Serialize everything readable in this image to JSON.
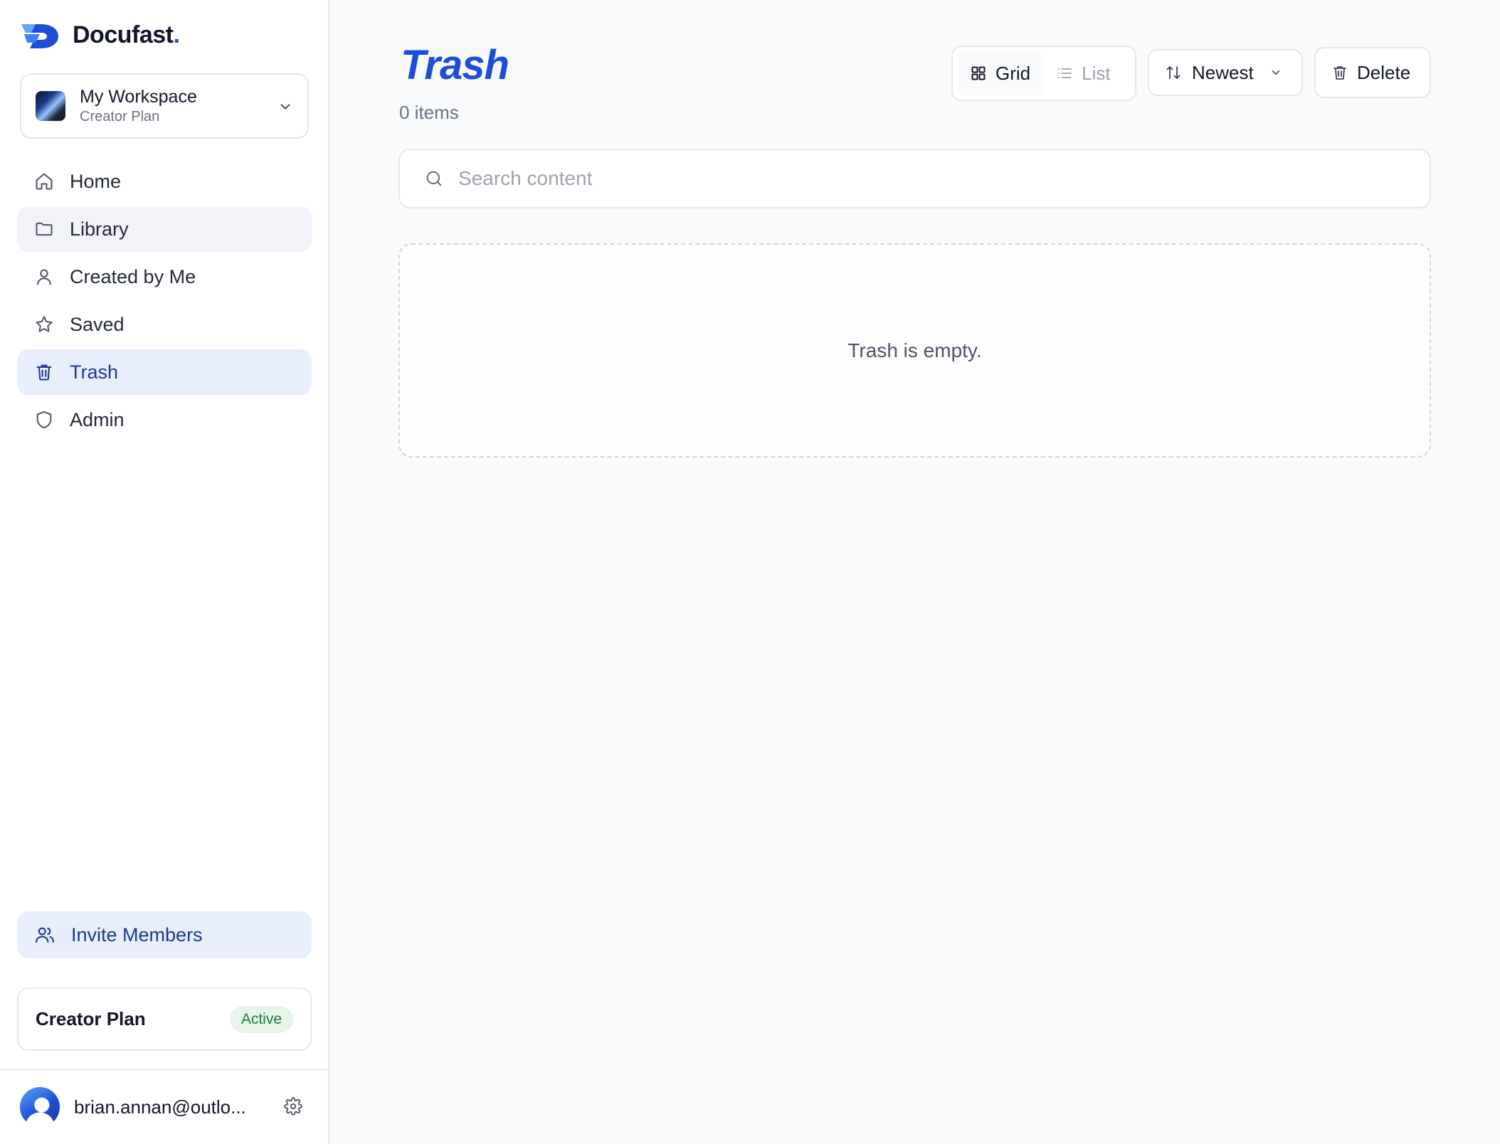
{
  "brand": {
    "name": "Docufast",
    "dot": ".",
    "accent": "#1d4ed8"
  },
  "workspace": {
    "name": "My Workspace",
    "plan": "Creator Plan"
  },
  "nav": [
    {
      "label": "Home",
      "icon": "home-icon",
      "state": "normal"
    },
    {
      "label": "Library",
      "icon": "folder-icon",
      "state": "hover"
    },
    {
      "label": "Created by Me",
      "icon": "user-icon",
      "state": "normal"
    },
    {
      "label": "Saved",
      "icon": "star-icon",
      "state": "normal"
    },
    {
      "label": "Trash",
      "icon": "trash-icon",
      "state": "active"
    },
    {
      "label": "Admin",
      "icon": "shield-icon",
      "state": "normal"
    }
  ],
  "invite": {
    "label": "Invite Members",
    "icon": "users-icon"
  },
  "plan_card": {
    "name": "Creator Plan",
    "status": "Active",
    "status_color": "#15803d"
  },
  "user": {
    "email": "brian.annan@outlo...",
    "settings_icon": "gear-icon"
  },
  "page": {
    "title": "Trash",
    "count": "0 items"
  },
  "toolbar": {
    "view_grid": "Grid",
    "view_list": "List",
    "selected_view": "Grid",
    "sort_label": "Newest",
    "delete_label": "Delete"
  },
  "search": {
    "placeholder": "Search content",
    "value": ""
  },
  "empty_state": {
    "message": "Trash is empty."
  }
}
